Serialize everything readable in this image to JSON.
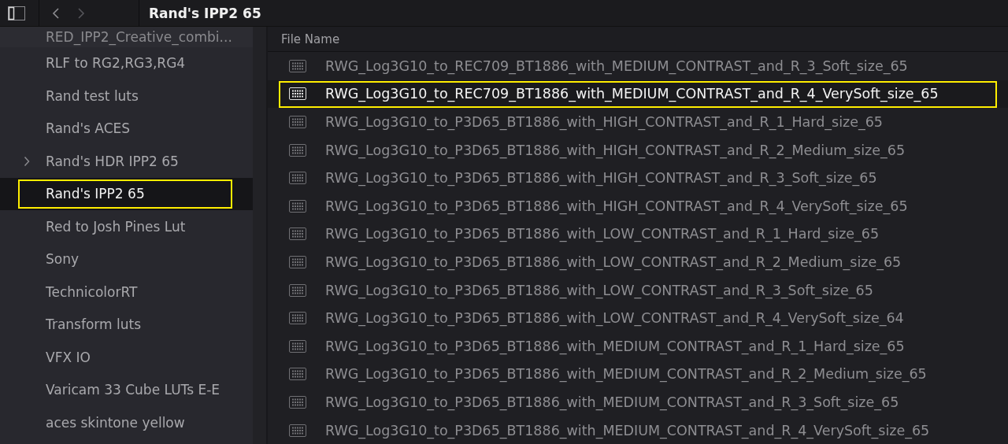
{
  "toolbar": {
    "title": "Rand's IPP2 65"
  },
  "sidebar": {
    "items": [
      {
        "label": "RED_IPP2_Creative_combi...",
        "expandable": false,
        "selected": false,
        "highlighted": false
      },
      {
        "label": "RLF to RG2,RG3,RG4",
        "expandable": false,
        "selected": false,
        "highlighted": false
      },
      {
        "label": "Rand test luts",
        "expandable": false,
        "selected": false,
        "highlighted": false
      },
      {
        "label": "Rand's ACES",
        "expandable": false,
        "selected": false,
        "highlighted": false
      },
      {
        "label": "Rand's HDR IPP2 65",
        "expandable": true,
        "selected": false,
        "highlighted": false
      },
      {
        "label": "Rand's IPP2 65",
        "expandable": false,
        "selected": true,
        "highlighted": true
      },
      {
        "label": "Red to Josh Pines Lut",
        "expandable": false,
        "selected": false,
        "highlighted": false
      },
      {
        "label": "Sony",
        "expandable": false,
        "selected": false,
        "highlighted": false
      },
      {
        "label": "TechnicolorRT",
        "expandable": false,
        "selected": false,
        "highlighted": false
      },
      {
        "label": "Transform luts",
        "expandable": false,
        "selected": false,
        "highlighted": false
      },
      {
        "label": "VFX IO",
        "expandable": false,
        "selected": false,
        "highlighted": false
      },
      {
        "label": "Varicam 33 Cube LUTs E-E",
        "expandable": false,
        "selected": false,
        "highlighted": false
      },
      {
        "label": "aces skintone yellow",
        "expandable": false,
        "selected": false,
        "highlighted": false
      }
    ]
  },
  "file_list": {
    "column": "File Name",
    "rows": [
      {
        "name": "RWG_Log3G10_to_REC709_BT1886_with_MEDIUM_CONTRAST_and_R_3_Soft_size_65",
        "selected": false,
        "highlighted": false
      },
      {
        "name": "RWG_Log3G10_to_REC709_BT1886_with_MEDIUM_CONTRAST_and_R_4_VerySoft_size_65",
        "selected": true,
        "highlighted": true
      },
      {
        "name": "RWG_Log3G10_to_P3D65_BT1886_with_HIGH_CONTRAST_and_R_1_Hard_size_65",
        "selected": false,
        "highlighted": false
      },
      {
        "name": "RWG_Log3G10_to_P3D65_BT1886_with_HIGH_CONTRAST_and_R_2_Medium_size_65",
        "selected": false,
        "highlighted": false
      },
      {
        "name": "RWG_Log3G10_to_P3D65_BT1886_with_HIGH_CONTRAST_and_R_3_Soft_size_65",
        "selected": false,
        "highlighted": false
      },
      {
        "name": "RWG_Log3G10_to_P3D65_BT1886_with_HIGH_CONTRAST_and_R_4_VerySoft_size_65",
        "selected": false,
        "highlighted": false
      },
      {
        "name": "RWG_Log3G10_to_P3D65_BT1886_with_LOW_CONTRAST_and_R_1_Hard_size_65",
        "selected": false,
        "highlighted": false
      },
      {
        "name": "RWG_Log3G10_to_P3D65_BT1886_with_LOW_CONTRAST_and_R_2_Medium_size_65",
        "selected": false,
        "highlighted": false
      },
      {
        "name": "RWG_Log3G10_to_P3D65_BT1886_with_LOW_CONTRAST_and_R_3_Soft_size_65",
        "selected": false,
        "highlighted": false
      },
      {
        "name": "RWG_Log3G10_to_P3D65_BT1886_with_LOW_CONTRAST_and_R_4_VerySoft_size_64",
        "selected": false,
        "highlighted": false
      },
      {
        "name": "RWG_Log3G10_to_P3D65_BT1886_with_MEDIUM_CONTRAST_and_R_1_Hard_size_65",
        "selected": false,
        "highlighted": false
      },
      {
        "name": "RWG_Log3G10_to_P3D65_BT1886_with_MEDIUM_CONTRAST_and_R_2_Medium_size_65",
        "selected": false,
        "highlighted": false
      },
      {
        "name": "RWG_Log3G10_to_P3D65_BT1886_with_MEDIUM_CONTRAST_and_R_3_Soft_size_65",
        "selected": false,
        "highlighted": false
      },
      {
        "name": "RWG_Log3G10_to_P3D65_BT1886_with_MEDIUM_CONTRAST_and_R_4_VerySoft_size_65",
        "selected": false,
        "highlighted": false
      }
    ]
  }
}
